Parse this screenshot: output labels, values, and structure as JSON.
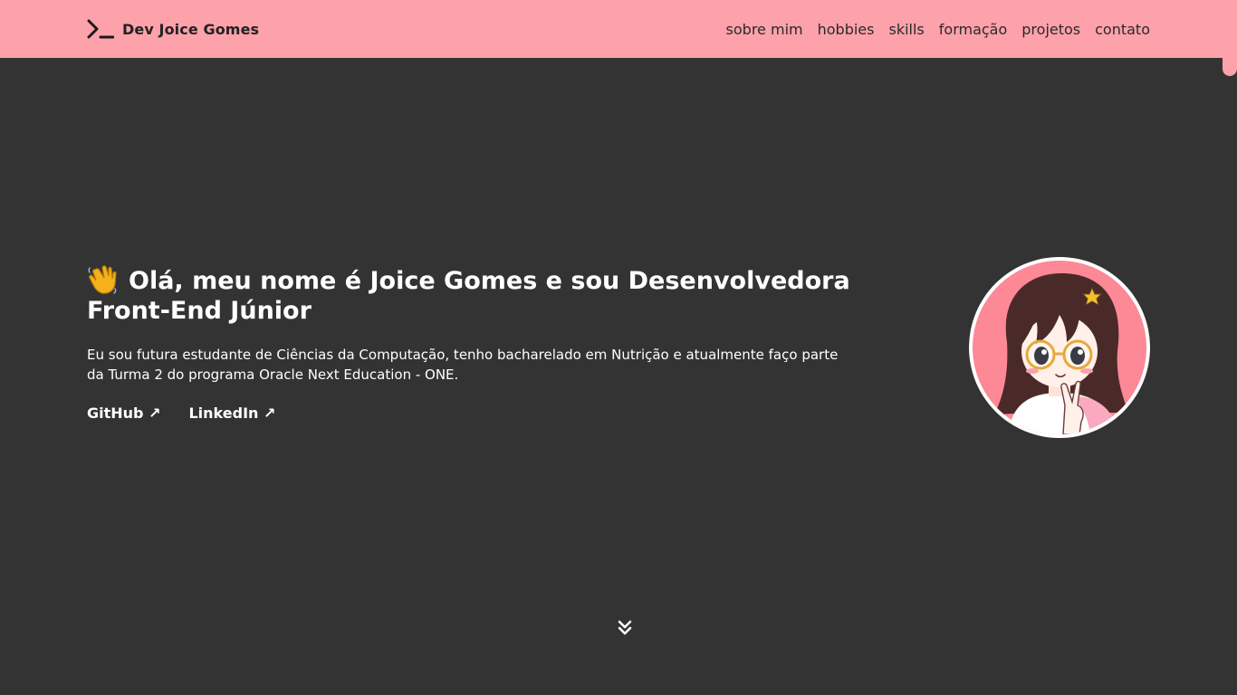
{
  "header": {
    "brand_label": "Dev Joice Gomes",
    "brand_icon": "terminal-prompt-icon",
    "background_color": "#fda1ab",
    "nav": [
      "sobre mim",
      "hobbies",
      "skills",
      "formação",
      "projetos",
      "contato"
    ]
  },
  "hero": {
    "title": "Olá, meu nome é Joice Gomes e sou Desenvolvedora Front-End Júnior",
    "title_icon": "waving-hand-icon",
    "description": "Eu sou futura estudante de Ciências da Computação, tenho bacharelado em Nutrição e atualmente faço parte da Turma 2 do programa Oracle Next Education - ONE.",
    "links": [
      "GitHub ↗",
      "LinkedIn ↗"
    ]
  },
  "profile_picture": {
    "icon": "anime-avatar-illustration",
    "frame_color": "#ffffff"
  },
  "scroll_down_icon": "double-chevron-down-icon",
  "colors": {
    "page_background": "#333333",
    "text": "#ffffff",
    "accent": "#fda1ab"
  }
}
